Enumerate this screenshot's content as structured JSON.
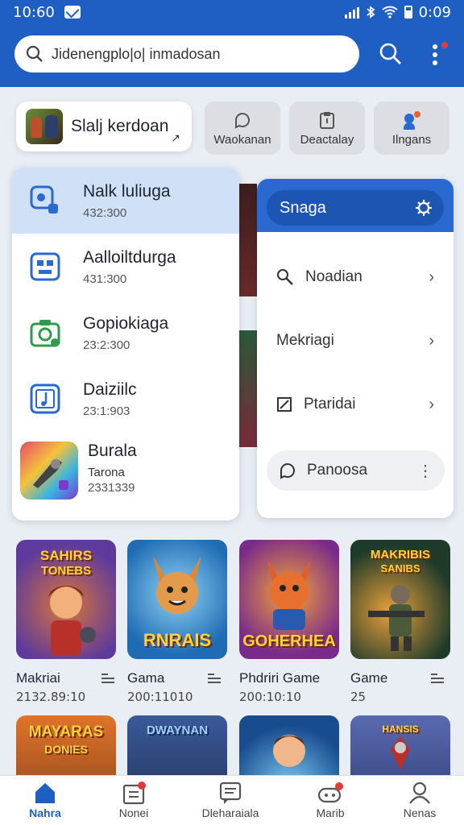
{
  "status_bar": {
    "time": "10:60",
    "clock": "0:09"
  },
  "search": {
    "placeholder": "Jidenengplo|o| inmadosan"
  },
  "quick": {
    "main_label": "Slalj kerdoan",
    "chips": [
      "Waokanan",
      "Deactalay",
      "Ilngans"
    ]
  },
  "left_menu": {
    "items": [
      {
        "title": "Nalk luliuga",
        "sub": "432:300",
        "icon": "app-search-icon",
        "selected": true
      },
      {
        "title": "Aalloiltdurga",
        "sub": "431:300",
        "icon": "robot-icon",
        "selected": false
      },
      {
        "title": "Gopiokiaga",
        "sub": "23:2:300",
        "icon": "camera-icon",
        "selected": false
      },
      {
        "title": "Daiziilc",
        "sub": "23:1:903",
        "icon": "music-icon",
        "selected": false
      },
      {
        "title": "Burala",
        "sub": "Tarona",
        "sub2": "2331339",
        "icon": "game-thumbnail",
        "selected": false
      }
    ]
  },
  "right_menu": {
    "header": "Snaga",
    "items": [
      {
        "label": "Noadian",
        "icon": "link-icon"
      },
      {
        "label": "Mekriagi",
        "icon": ""
      },
      {
        "label": "Ptaridai",
        "icon": "edit-icon"
      }
    ],
    "footer": "Panoosa"
  },
  "games": [
    {
      "name": "Makriai",
      "date": "2132.89:10",
      "art_top": "SAHIRS",
      "art_top2": "TONEBS",
      "bg": "#5e3a9c"
    },
    {
      "name": "Gama",
      "date": "200:11010",
      "art_bot": "RNRAIS",
      "bg": "#1f6bb4"
    },
    {
      "name": "Phdriri Game",
      "date": "200:10:10",
      "art_bot": "GOHERHEA",
      "bg": "#7a2a8a"
    },
    {
      "name": "Game",
      "date": "25",
      "art_top": "MAKRIBIS",
      "art_top2": "SANIBS",
      "bg": "#1e3a2a"
    }
  ],
  "games_row2": [
    {
      "art_top": "MAYARAS",
      "art_top2": "DONIES",
      "bg": "#b5571f"
    },
    {
      "art_top": "DWAYNAN",
      "bg": "#1e2a4a"
    },
    {
      "bg": "#184c8f"
    },
    {
      "art_top": "HANSIS",
      "bg": "#26356b"
    }
  ],
  "bottom_nav": [
    "Nahra",
    "Nonei",
    "Dleharaiala",
    "Marib",
    "Nenas"
  ],
  "colors": {
    "primary": "#1f5fc4",
    "selected_row": "#cfe0f7",
    "badge": "#e23b3b"
  }
}
